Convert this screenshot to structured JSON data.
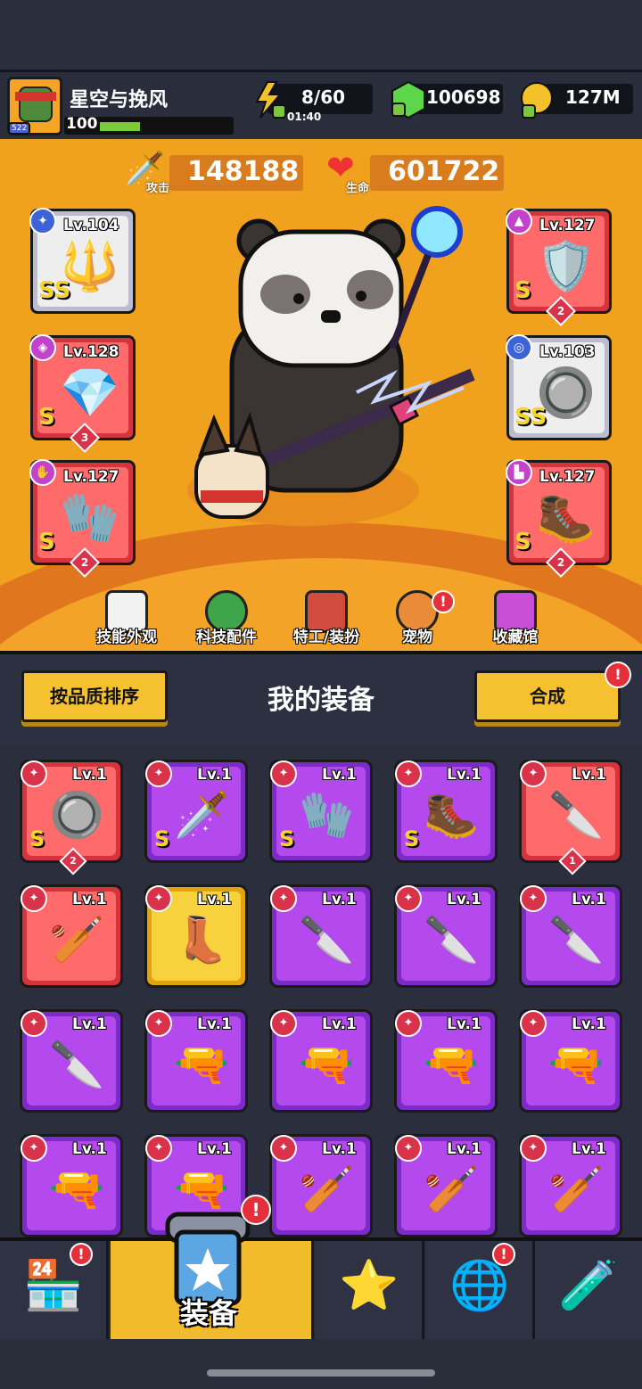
{
  "player": {
    "name": "星空与挽风",
    "level": "100",
    "rank_badge": "522",
    "level_progress": 0.3
  },
  "resources": {
    "energy": "8/60",
    "energy_timer": "01:40",
    "gems": "100698",
    "gold": "127M"
  },
  "stats": {
    "attack_label": "攻击",
    "attack": "148188",
    "hp_label": "生命",
    "hp": "601722"
  },
  "equipped_left": [
    {
      "lv": "Lv.104",
      "rank": "SS",
      "color": "silver",
      "icon": "staff-icon",
      "count": ""
    },
    {
      "lv": "Lv.128",
      "rank": "S",
      "color": "red",
      "icon": "necklace-icon",
      "count": "3"
    },
    {
      "lv": "Lv.127",
      "rank": "S",
      "color": "red",
      "icon": "gauntlet-icon",
      "count": "2"
    }
  ],
  "equipped_right": [
    {
      "lv": "Lv.127",
      "rank": "S",
      "color": "red",
      "icon": "armor-icon",
      "count": "2"
    },
    {
      "lv": "Lv.103",
      "rank": "SS",
      "color": "silver",
      "icon": "belt-icon",
      "count": ""
    },
    {
      "lv": "Lv.127",
      "rank": "S",
      "color": "red",
      "icon": "boots-icon",
      "count": "2"
    }
  ],
  "menu": [
    {
      "label": "技能外观",
      "badge": ""
    },
    {
      "label": "科技配件",
      "badge": ""
    },
    {
      "label": "特工/装扮",
      "badge": ""
    },
    {
      "label": "宠物",
      "badge": "!"
    },
    {
      "label": "收藏馆",
      "badge": ""
    }
  ],
  "equipment_header": {
    "sort_label": "按品质排序",
    "title": "我的装备",
    "merge_label": "合成",
    "merge_badge": "!"
  },
  "inventory": [
    {
      "lv": "Lv.1",
      "color": "red",
      "rank": "S",
      "count": "2",
      "icon": "belt-icon"
    },
    {
      "lv": "Lv.1",
      "color": "purple",
      "rank": "S",
      "count": "",
      "icon": "sword-icon"
    },
    {
      "lv": "Lv.1",
      "color": "purple",
      "rank": "S",
      "count": "",
      "icon": "gauntlet-icon"
    },
    {
      "lv": "Lv.1",
      "color": "purple",
      "rank": "S",
      "count": "",
      "icon": "boots-icon"
    },
    {
      "lv": "Lv.1",
      "color": "red",
      "rank": "",
      "count": "1",
      "icon": "kunai-icon"
    },
    {
      "lv": "Lv.1",
      "color": "red",
      "rank": "",
      "count": "",
      "icon": "bat-icon"
    },
    {
      "lv": "Lv.1",
      "color": "gold",
      "rank": "",
      "count": "",
      "icon": "boot-icon"
    },
    {
      "lv": "Lv.1",
      "color": "purple",
      "rank": "",
      "count": "",
      "icon": "kunai-icon"
    },
    {
      "lv": "Lv.1",
      "color": "purple",
      "rank": "",
      "count": "",
      "icon": "kunai-icon"
    },
    {
      "lv": "Lv.1",
      "color": "purple",
      "rank": "",
      "count": "",
      "icon": "machete-icon"
    },
    {
      "lv": "Lv.1",
      "color": "purple",
      "rank": "",
      "count": "",
      "icon": "machete-icon"
    },
    {
      "lv": "Lv.1",
      "color": "purple",
      "rank": "",
      "count": "",
      "icon": "revolver-icon"
    },
    {
      "lv": "Lv.1",
      "color": "purple",
      "rank": "",
      "count": "",
      "icon": "revolver-icon"
    },
    {
      "lv": "Lv.1",
      "color": "purple",
      "rank": "",
      "count": "",
      "icon": "revolver-icon"
    },
    {
      "lv": "Lv.1",
      "color": "purple",
      "rank": "",
      "count": "",
      "icon": "shotgun-icon"
    },
    {
      "lv": "Lv.1",
      "color": "purple",
      "rank": "",
      "count": "",
      "icon": "shotgun-icon"
    },
    {
      "lv": "Lv.1",
      "color": "purple",
      "rank": "",
      "count": "",
      "icon": "shotgun-icon"
    },
    {
      "lv": "Lv.1",
      "color": "purple",
      "rank": "",
      "count": "",
      "icon": "bat-icon"
    },
    {
      "lv": "Lv.1",
      "color": "purple",
      "rank": "",
      "count": "",
      "icon": "bat-icon"
    },
    {
      "lv": "Lv.1",
      "color": "purple",
      "rank": "",
      "count": "",
      "icon": "bat-icon"
    }
  ],
  "nav": {
    "active_label": "装备",
    "badge": "!"
  }
}
